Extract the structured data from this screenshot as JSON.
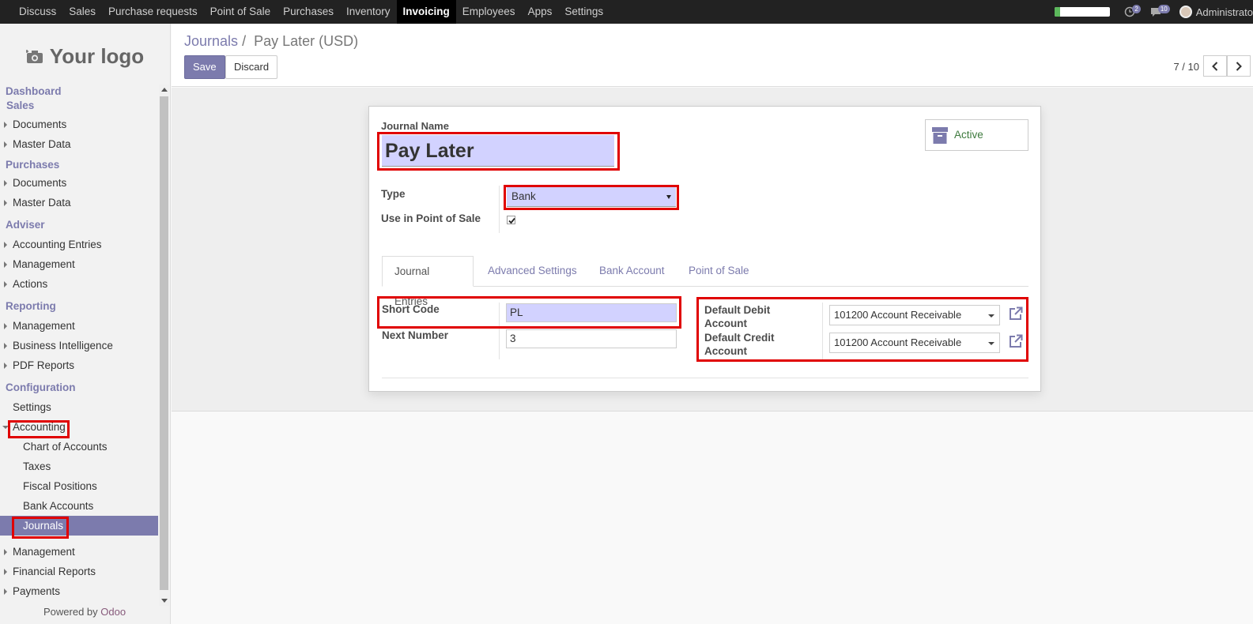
{
  "topmenu": [
    "Discuss",
    "Sales",
    "Purchase requests",
    "Point of Sale",
    "Purchases",
    "Inventory",
    "Invoicing",
    "Employees",
    "Apps",
    "Settings"
  ],
  "topmenu_active": "Invoicing",
  "progress_fraction": 0.1,
  "notifications": {
    "activity_count": "2",
    "message_count": "10"
  },
  "user": {
    "name": "Administrato"
  },
  "logo_text": "Your logo",
  "sidebar": {
    "dashboard": "Dashboard",
    "sales": "Sales",
    "sales_items": [
      "Documents",
      "Master Data"
    ],
    "purchases": "Purchases",
    "purchases_items": [
      "Documents",
      "Master Data"
    ],
    "adviser": "Adviser",
    "adviser_items": [
      "Accounting Entries",
      "Management",
      "Actions"
    ],
    "reporting": "Reporting",
    "reporting_items": [
      "Management",
      "Business Intelligence",
      "PDF Reports"
    ],
    "configuration": "Configuration",
    "settings": "Settings",
    "accounting": "Accounting",
    "accounting_items": [
      "Chart of Accounts",
      "Taxes",
      "Fiscal Positions",
      "Bank Accounts",
      "Journals"
    ],
    "after_items": [
      "Management",
      "Financial Reports",
      "Payments"
    ],
    "powered_prefix": "Powered by",
    "powered_brand": "Odoo"
  },
  "breadcrumb": {
    "parent": "Journals",
    "separator": "/",
    "current": "Pay Later (USD)"
  },
  "buttons": {
    "save": "Save",
    "discard": "Discard"
  },
  "pager": {
    "value": "7 / 10"
  },
  "form": {
    "journal_name_label": "Journal Name",
    "journal_name": "Pay Later",
    "active_label": "Active",
    "type_label": "Type",
    "type_value": "Bank",
    "pos_label": "Use in Point of Sale",
    "pos_checked": true,
    "tabs": [
      "Journal Entries",
      "Advanced Settings",
      "Bank Account",
      "Point of Sale"
    ],
    "short_code_label": "Short Code",
    "short_code": "PL",
    "next_number_label": "Next Number",
    "next_number": "3",
    "debit_label_1": "Default Debit",
    "debit_label_2": "Account",
    "debit_value": "101200 Account Receivable",
    "credit_label_1": "Default Credit",
    "credit_label_2": "Account",
    "credit_value": "101200 Account Receivable"
  },
  "colors": {
    "accent": "#7c7bad",
    "highlight": "#e00000",
    "required_bg": "#d2d2ff"
  }
}
